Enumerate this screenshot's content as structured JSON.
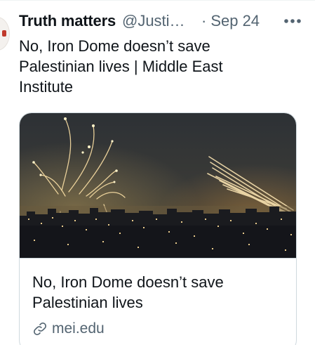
{
  "tweet": {
    "author_name": "Truth matters",
    "author_handle": "@Justi…",
    "separator": "·",
    "date": "Sep 24",
    "more_icon": "more-horizontal-icon",
    "text": "No, Iron Dome doesn’t save Palestinian lives | Middle East Institute"
  },
  "card": {
    "image_description_icon": "night-city-rockets-photo",
    "title": "No, Iron Dome doesn’t save Palestinian lives",
    "link_icon": "link-icon",
    "domain": "mei.edu"
  },
  "colors": {
    "text_primary": "#0f1419",
    "text_secondary": "#536471",
    "border": "#cfd9de"
  }
}
